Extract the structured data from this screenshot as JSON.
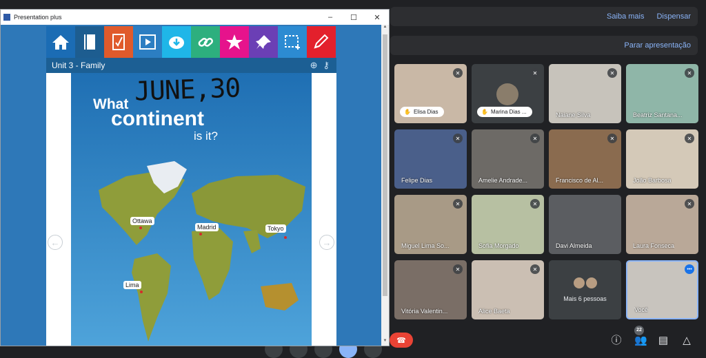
{
  "window": {
    "title": "Presentation plus",
    "controls": [
      "–",
      "☐",
      "✕"
    ]
  },
  "book": {
    "unit_title": "Unit 3 - Family",
    "handwriting": "JUNE,30",
    "heading": {
      "line1": "What",
      "line2": "continent",
      "line3": "is it?"
    },
    "cities": [
      "Ottawa",
      "Madrid",
      "Tokyo",
      "Lima"
    ],
    "toolbar_colors": [
      "#1b6cb4",
      "#1d5d90",
      "#e05a2b",
      "#2c7ec2",
      "#1fb6e8",
      "#2daf7e",
      "#e6138c",
      "#6b3fb5",
      "#2c8bd2",
      "#e3202c"
    ]
  },
  "meet": {
    "top_bar": {
      "learn_more": "Saiba mais",
      "dismiss": "Dispensar"
    },
    "presentation_bar": {
      "stop": "Parar apresentação"
    },
    "participants": [
      {
        "name": "Elisa Dias",
        "style": "pill",
        "bg": "#c9b8a6"
      },
      {
        "name": "Marina Dias ...",
        "style": "pill-avatar",
        "bg": "#3c4043"
      },
      {
        "name": "Naiane Silva",
        "style": "name",
        "bg": "#c7c3bb"
      },
      {
        "name": "Beatriz Santana...",
        "style": "name",
        "bg": "#8fb6a8"
      },
      {
        "name": "Felipe Dias",
        "style": "name",
        "bg": "#4a5f8a"
      },
      {
        "name": "Amelie Andrade...",
        "style": "name",
        "bg": "#6d6a66"
      },
      {
        "name": "Francisco de Al...",
        "style": "name",
        "bg": "#8a6b4f"
      },
      {
        "name": "João Barbosa",
        "style": "name",
        "bg": "#d4c9b8"
      },
      {
        "name": "Miguel Lima So...",
        "style": "name",
        "bg": "#a89a86"
      },
      {
        "name": "Sofia Morgado",
        "style": "name",
        "bg": "#b7c0a2"
      },
      {
        "name": "Davi Almeida",
        "style": "name",
        "bg": "#5b5d61"
      },
      {
        "name": "Laura Fonseca",
        "style": "name",
        "bg": "#b9a898"
      },
      {
        "name": "Vitória Valentin...",
        "style": "name",
        "bg": "#7a6e66"
      },
      {
        "name": "Alice Baeta",
        "style": "name",
        "bg": "#cbbfb3"
      }
    ],
    "more_people": "Mais 6 pessoas",
    "self_label": "Você",
    "participant_count": "22",
    "icons": [
      "info-icon",
      "people-icon",
      "chat-icon",
      "activities-icon"
    ]
  }
}
